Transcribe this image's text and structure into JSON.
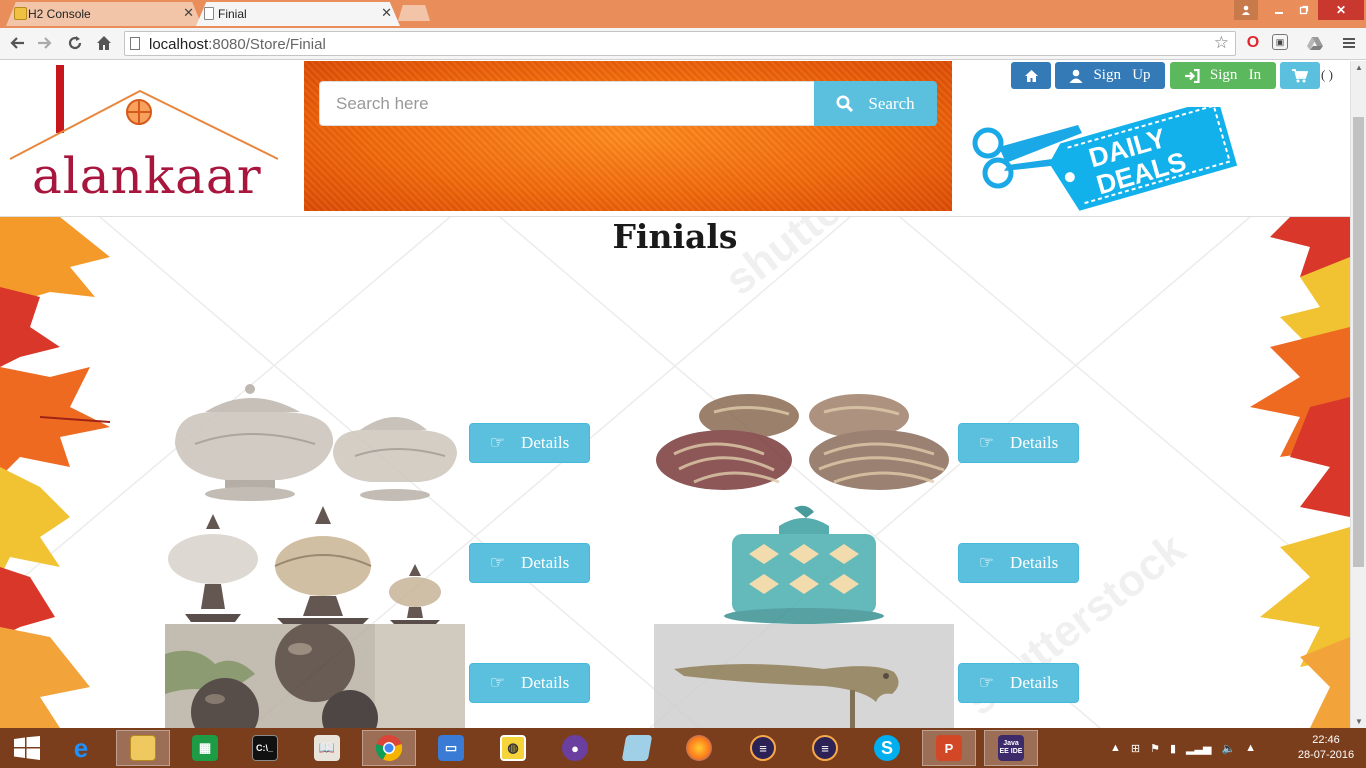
{
  "browser": {
    "tabs": [
      {
        "label": "H2 Console"
      },
      {
        "label": "Finial"
      }
    ],
    "url_host": "localhost",
    "url_rest": ":8080/Store/Finial"
  },
  "header": {
    "logo_text": "alankaar",
    "search_placeholder": "Search here",
    "search_button": "Search",
    "signup": "Sign   Up",
    "signin": "Sign   In",
    "cart_count": "( )",
    "deals_line1": "DAILY",
    "deals_line2": "DEALS"
  },
  "main": {
    "title": "Finials",
    "details_label": "Details",
    "products": [
      {
        "name": "wooden-urn-finials"
      },
      {
        "name": "striped-glass-finials"
      },
      {
        "name": "iron-crown-finials"
      },
      {
        "name": "teal-lantern-finial"
      },
      {
        "name": "smoky-glass-ball-finials"
      },
      {
        "name": "brass-parrot-finial"
      }
    ]
  },
  "taskbar": {
    "time": "22:46",
    "date": "28-07-2016"
  },
  "colors": {
    "info": "#5bc0de",
    "primary": "#337ab7",
    "success": "#5cb85c",
    "logo": "#a8163d",
    "chrome_frame": "#e98d5a",
    "taskbar": "#7a3e1c"
  }
}
